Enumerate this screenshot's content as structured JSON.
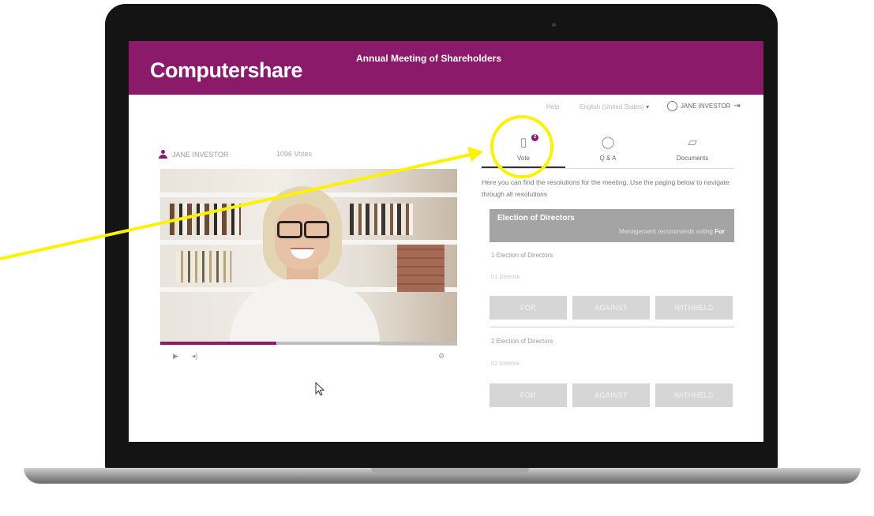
{
  "header": {
    "logo": "Computershare",
    "meeting_title": "Annual Meeting of Shareholders"
  },
  "utility_bar": {
    "help": "Help",
    "language": "English (United States)",
    "user_name": "JANE INVESTOR"
  },
  "video_panel": {
    "viewer_name": "JANE INVESTOR",
    "votes": "1096 Votes",
    "progress": 0.39
  },
  "tabs": [
    {
      "label": "Vote",
      "badge": "2",
      "icon": "document-icon"
    },
    {
      "label": "Q & A",
      "icon": "chat-bubble-icon"
    },
    {
      "label": "Documents",
      "icon": "folder-icon"
    }
  ],
  "vote": {
    "intro": "Here you can find the resolutions for the meeting. Use the paging below to navigate through all resolutions",
    "section_title": "Election of Directors",
    "recommendation_prefix": "Management recommends voting",
    "recommendation_value": "For",
    "resolutions": [
      {
        "title": "1 Election of Directors",
        "director": "01 Director",
        "buttons": [
          "FOR",
          "AGAINST",
          "WITHHELD"
        ]
      },
      {
        "title": "2 Election of Directors",
        "director": "02 Director",
        "buttons": [
          "FOR",
          "AGAINST",
          "WITHHELD"
        ]
      }
    ]
  },
  "colors": {
    "brand": "#8b1a6a",
    "highlight": "#fff200"
  }
}
